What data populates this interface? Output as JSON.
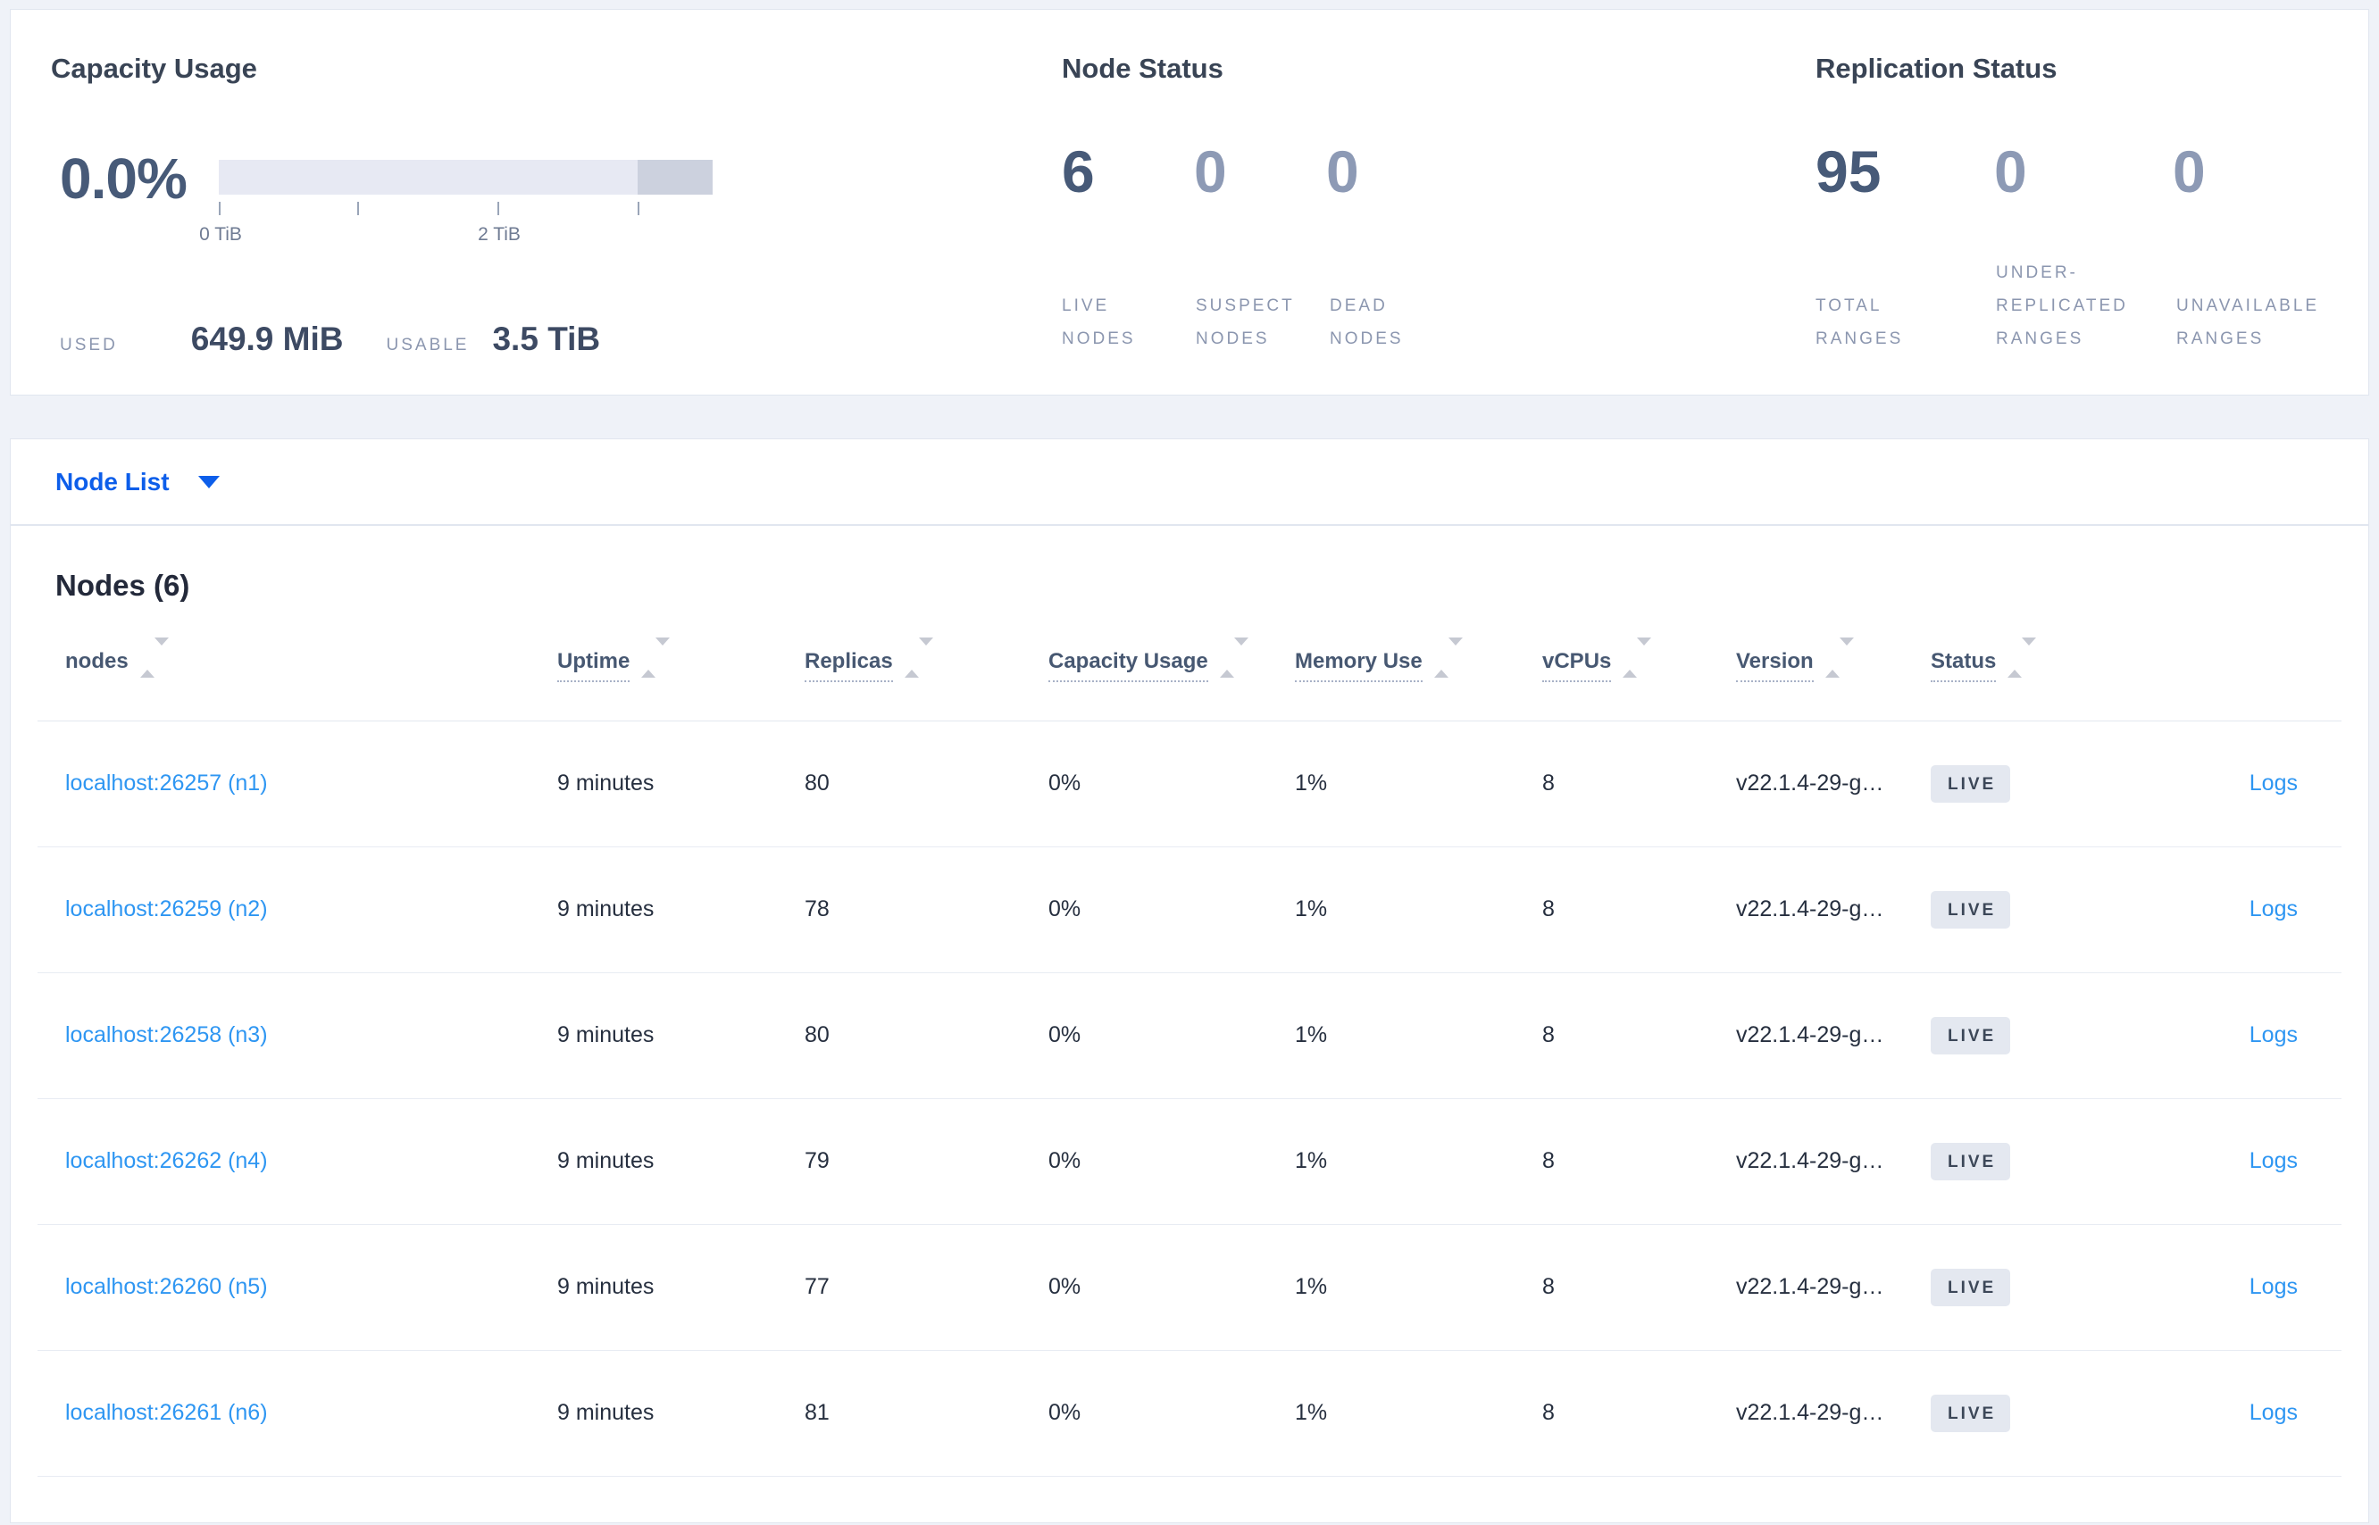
{
  "colors": {
    "selector_blue": "#0d5eea",
    "table_link_blue": "#2e96f2",
    "badge_bg": "#e4e8f0",
    "badge_text": "#3c4758",
    "bar_track": "#e7e9f3",
    "bar_segment": "#ccd1de"
  },
  "summary": {
    "capacity": {
      "title": "Capacity Usage",
      "percent": "0.0%",
      "tick_labels": [
        "0 TiB",
        "2 TiB"
      ],
      "used_label": "USED",
      "used_value": "649.9 MiB",
      "usable_label": "USABLE",
      "usable_value": "3.5 TiB"
    },
    "node_status": {
      "title": "Node Status",
      "stats": [
        {
          "value": "6",
          "label": "LIVE NODES"
        },
        {
          "value": "0",
          "label": "SUSPECT NODES"
        },
        {
          "value": "0",
          "label": "DEAD NODES"
        }
      ]
    },
    "replication": {
      "title": "Replication Status",
      "stats": [
        {
          "value": "95",
          "label": "TOTAL RANGES"
        },
        {
          "value": "0",
          "label": "UNDER-REPLICATED RANGES"
        },
        {
          "value": "0",
          "label": "UNAVAILABLE RANGES"
        }
      ]
    }
  },
  "view_selector": {
    "label": "Node List"
  },
  "nodes": {
    "heading": "Nodes (6)",
    "columns": {
      "nodes": "nodes",
      "uptime": "Uptime",
      "replicas": "Replicas",
      "capacity": "Capacity Usage",
      "memory": "Memory Use",
      "vcpus": "vCPUs",
      "version": "Version",
      "status": "Status"
    },
    "rows": [
      {
        "address": "localhost:26257 (n1)",
        "uptime": "9 minutes",
        "replicas": "80",
        "capacity": "0%",
        "memory": "1%",
        "vcpus": "8",
        "version": "v22.1.4-29-g…",
        "status": "LIVE",
        "logs": "Logs"
      },
      {
        "address": "localhost:26259 (n2)",
        "uptime": "9 minutes",
        "replicas": "78",
        "capacity": "0%",
        "memory": "1%",
        "vcpus": "8",
        "version": "v22.1.4-29-g…",
        "status": "LIVE",
        "logs": "Logs"
      },
      {
        "address": "localhost:26258 (n3)",
        "uptime": "9 minutes",
        "replicas": "80",
        "capacity": "0%",
        "memory": "1%",
        "vcpus": "8",
        "version": "v22.1.4-29-g…",
        "status": "LIVE",
        "logs": "Logs"
      },
      {
        "address": "localhost:26262 (n4)",
        "uptime": "9 minutes",
        "replicas": "79",
        "capacity": "0%",
        "memory": "1%",
        "vcpus": "8",
        "version": "v22.1.4-29-g…",
        "status": "LIVE",
        "logs": "Logs"
      },
      {
        "address": "localhost:26260 (n5)",
        "uptime": "9 minutes",
        "replicas": "77",
        "capacity": "0%",
        "memory": "1%",
        "vcpus": "8",
        "version": "v22.1.4-29-g…",
        "status": "LIVE",
        "logs": "Logs"
      },
      {
        "address": "localhost:26261 (n6)",
        "uptime": "9 minutes",
        "replicas": "81",
        "capacity": "0%",
        "memory": "1%",
        "vcpus": "8",
        "version": "v22.1.4-29-g…",
        "status": "LIVE",
        "logs": "Logs"
      }
    ]
  }
}
